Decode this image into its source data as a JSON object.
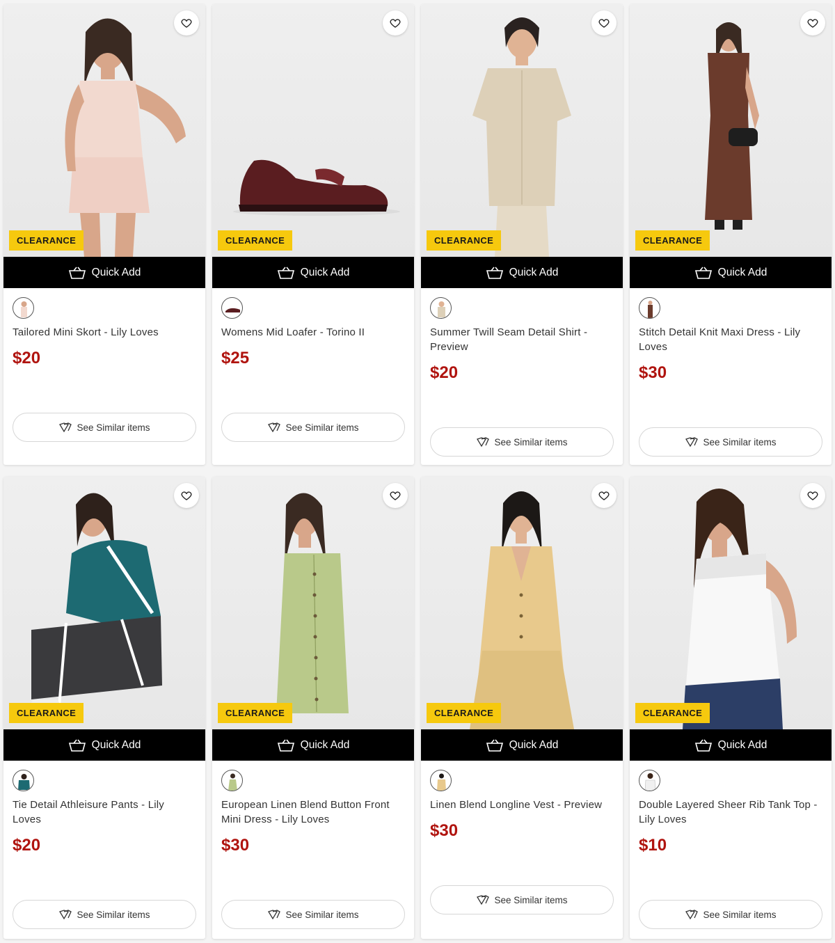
{
  "products": [
    {
      "title": "Tailored Mini Skort - Lily Loves",
      "price": "$20",
      "badge": "CLEARANCE",
      "quick_add": "Quick Add",
      "see_similar": "See Similar items"
    },
    {
      "title": "Womens Mid Loafer - Torino II",
      "price": "$25",
      "badge": "CLEARANCE",
      "quick_add": "Quick Add",
      "see_similar": "See Similar items"
    },
    {
      "title": "Summer Twill Seam Detail Shirt - Preview",
      "price": "$20",
      "badge": "CLEARANCE",
      "quick_add": "Quick Add",
      "see_similar": "See Similar items"
    },
    {
      "title": "Stitch Detail Knit Maxi Dress - Lily Loves",
      "price": "$30",
      "badge": "CLEARANCE",
      "quick_add": "Quick Add",
      "see_similar": "See Similar items"
    },
    {
      "title": "Tie Detail Athleisure Pants - Lily Loves",
      "price": "$20",
      "badge": "CLEARANCE",
      "quick_add": "Quick Add",
      "see_similar": "See Similar items"
    },
    {
      "title": "European Linen Blend Button Front Mini Dress - Lily Loves",
      "price": "$30",
      "badge": "CLEARANCE",
      "quick_add": "Quick Add",
      "see_similar": "See Similar items"
    },
    {
      "title": "Linen Blend Longline Vest - Preview",
      "price": "$30",
      "badge": "CLEARANCE",
      "quick_add": "Quick Add",
      "see_similar": "See Similar items"
    },
    {
      "title": "Double Layered Sheer Rib Tank Top - Lily Loves",
      "price": "$10",
      "badge": "CLEARANCE",
      "quick_add": "Quick Add",
      "see_similar": "See Similar items"
    }
  ],
  "colors": {
    "badge_bg": "#f6c90e",
    "price": "#b0140f",
    "quick_add_bg": "#000000"
  },
  "icons": {
    "wishlist": "heart-outline-icon",
    "quick_add": "basket-icon",
    "see_similar": "similar-icon"
  }
}
